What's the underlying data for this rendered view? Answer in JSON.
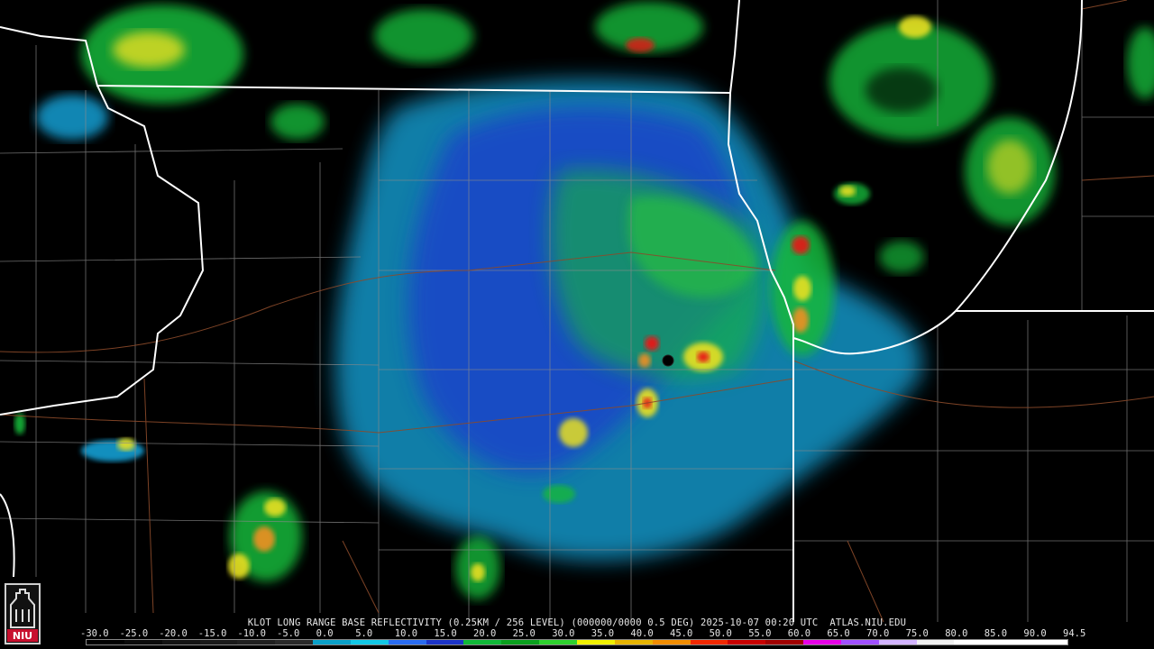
{
  "product": {
    "caption": "KLOT LONG RANGE BASE REFLECTIVITY (0.25KM / 256 LEVEL) (000000/0000 0.5 DEG) 2025-10-07 00:20 UTC  ATLAS.NIU.EDU"
  },
  "scale": {
    "labels": [
      "-30.0",
      "-25.0",
      "-20.0",
      "-15.0",
      "-10.0",
      "-5.0",
      "0.0",
      "5.0",
      "10.0",
      "15.0",
      "20.0",
      "25.0",
      "30.0",
      "35.0",
      "40.0",
      "45.0",
      "50.0",
      "55.0",
      "60.0",
      "65.0",
      "70.0",
      "75.0",
      "80.0",
      "85.0",
      "90.0",
      "94.5"
    ],
    "colors": [
      "#000000",
      "#0a0a0a",
      "#141414",
      "#1a1a1a",
      "#202020",
      "#2a2a2a",
      "#0aa0c8",
      "#12c8e6",
      "#2a6cf0",
      "#1c34c8",
      "#10b838",
      "#0aa01e",
      "#2ed02e",
      "#f0f000",
      "#e6b400",
      "#f08c00",
      "#f02800",
      "#c80000",
      "#a00000",
      "#e600e6",
      "#a050ff",
      "#d2b4ff",
      "#f0f0f0",
      "#ffffff",
      "#ffffff",
      "#ffffff"
    ]
  },
  "logo": {
    "text": "NIU"
  },
  "colors": {
    "state_line": "#ffffff",
    "county_line": "#8a8a8a",
    "road": "#8b4a2a",
    "light_blue": "#19a8e0",
    "blue": "#1c38d0",
    "green": "#14b83a",
    "yellow": "#e8e020",
    "orange": "#f09020",
    "red": "#e81818"
  },
  "icons": {
    "radar_site": "radar-site-icon",
    "logo": "niu-logo-icon"
  }
}
